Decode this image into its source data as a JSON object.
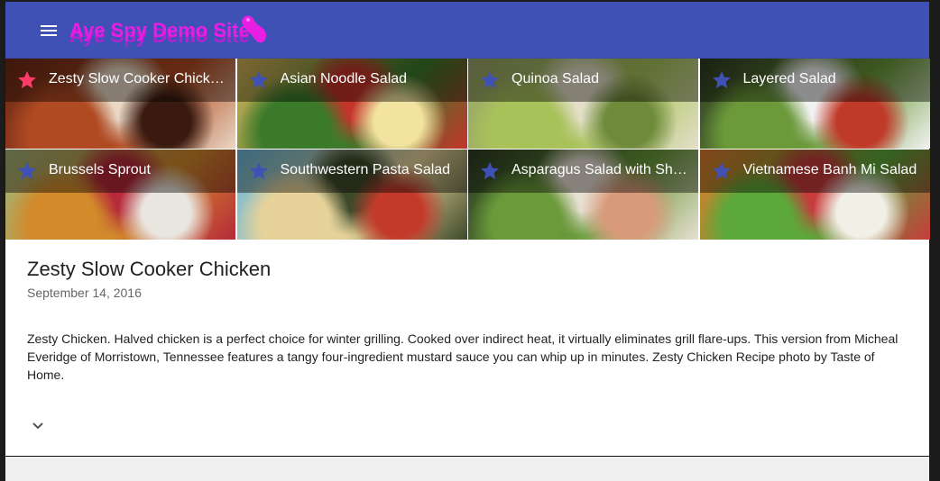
{
  "toolbar": {
    "title": "Aye Spy Demo Site",
    "accent": "#3f51b5",
    "title_color": "#e91ee3",
    "menu_icon": "hamburger-menu-icon",
    "logo_icon": "spy-logo-icon"
  },
  "tiles": [
    {
      "label": "Zesty Slow Cooker Chicken",
      "starred": true,
      "palette": [
        "#6b2a16",
        "#b04a22",
        "#e9d7c4",
        "#3a1a10"
      ]
    },
    {
      "label": "Asian Noodle Salad",
      "starred": false,
      "palette": [
        "#d9b25a",
        "#3a7a2a",
        "#c3342a",
        "#f2e3a0"
      ]
    },
    {
      "label": "Quinoa Salad",
      "starred": false,
      "palette": [
        "#9aa56a",
        "#a8c25a",
        "#e3dfc8",
        "#6e8a3a"
      ]
    },
    {
      "label": "Layered Salad",
      "starred": false,
      "palette": [
        "#2d3a22",
        "#6c9a3a",
        "#f2f2f2",
        "#c03a2a"
      ]
    },
    {
      "label": "Brussels Sprout",
      "starred": false,
      "palette": [
        "#a2b47a",
        "#d28a2a",
        "#b62a3a",
        "#e9e5df"
      ]
    },
    {
      "label": "Southwestern Pasta Salad",
      "starred": false,
      "palette": [
        "#6cb8d8",
        "#e7d39a",
        "#3d4a2a",
        "#c43a2a"
      ]
    },
    {
      "label": "Asparagus Salad with Shrimp",
      "starred": false,
      "palette": [
        "#2b3a22",
        "#6a9a3a",
        "#e7dfd2",
        "#d99a7a"
      ]
    },
    {
      "label": "Vietnamese Banh Mi Salad",
      "starred": false,
      "palette": [
        "#e07a2a",
        "#5ca83a",
        "#c73b3b",
        "#f2efe6"
      ]
    }
  ],
  "star_colors": {
    "active": "#ff3b6a",
    "inactive": "#3f51b5"
  },
  "detail": {
    "title": "Zesty Slow Cooker Chicken",
    "date": "September 14, 2016",
    "body": "Zesty Chicken. Halved chicken is a perfect choice for winter grilling. Cooked over indirect heat, it virtually eliminates grill flare-ups. This version from Micheal Everidge of Morristown, Tennessee features a tangy four-ingredient mustard sauce you can whip up in minutes. Zesty Chicken Recipe photo by Taste of Home.",
    "expand_icon": "chevron-down-icon"
  }
}
